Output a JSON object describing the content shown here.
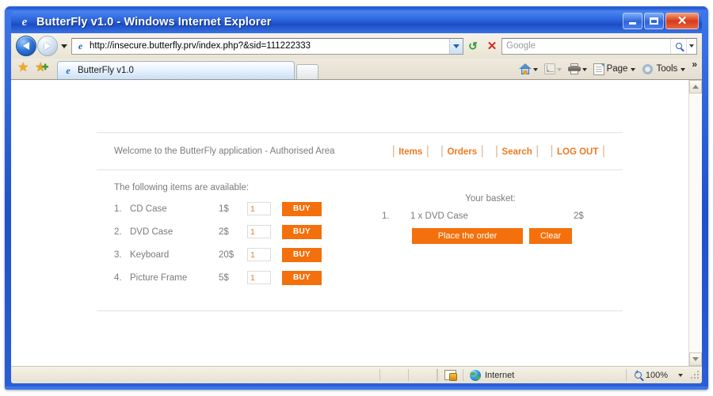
{
  "window": {
    "title": "ButterFly v1.0 - Windows Internet Explorer",
    "icon": "ie-logo-icon",
    "minimize_label": "Minimize",
    "maximize_label": "Maximize",
    "close_label": "Close"
  },
  "browser": {
    "back_label": "Back",
    "forward_label": "Forward",
    "history_dropdown_label": "Recent Pages",
    "address": {
      "url": "http://insecure.butterfly.prv/index.php?&sid=111222333",
      "icon": "ie-logo-icon",
      "dropdown_label": "Address history"
    },
    "refresh_label": "Refresh",
    "stop_label": "Stop",
    "search": {
      "placeholder": "Google",
      "go_label": "Search",
      "provider_dropdown_label": "Change search provider"
    },
    "favorites_center_label": "Favorites Center",
    "add_favorites_label": "Add to Favorites",
    "tabs": [
      {
        "label": "ButterFly v1.0",
        "icon": "ie-logo-icon",
        "active": true
      }
    ],
    "new_tab_label": "New Tab",
    "command_bar": [
      {
        "name": "home",
        "label": "",
        "icon": "home-icon",
        "has_dropdown": true,
        "enabled": true
      },
      {
        "name": "feeds",
        "label": "",
        "icon": "feed-icon",
        "has_dropdown": true,
        "enabled": false
      },
      {
        "name": "print",
        "label": "",
        "icon": "printer-icon",
        "has_dropdown": true,
        "enabled": true
      },
      {
        "name": "page",
        "label": "Page",
        "icon": "page-icon",
        "has_dropdown": true,
        "enabled": true
      },
      {
        "name": "tools",
        "label": "Tools",
        "icon": "gear-icon",
        "has_dropdown": true,
        "enabled": true
      }
    ],
    "command_overflow_label": "»"
  },
  "page": {
    "welcome": "Welcome to the ButterFly application - Authorised Area",
    "nav": [
      {
        "label": "Items",
        "id": "items"
      },
      {
        "label": "Orders",
        "id": "orders"
      },
      {
        "label": "Search",
        "id": "search"
      },
      {
        "label": "LOG OUT",
        "id": "logout"
      }
    ],
    "nav_pipe": "|",
    "items_heading": "The following items are available:",
    "items": [
      {
        "num": "1.",
        "name": "CD Case",
        "price": "1$",
        "qty": "1",
        "buy_label": "BUY"
      },
      {
        "num": "2.",
        "name": "DVD Case",
        "price": "2$",
        "qty": "1",
        "buy_label": "BUY"
      },
      {
        "num": "3.",
        "name": "Keyboard",
        "price": "20$",
        "qty": "1",
        "buy_label": "BUY"
      },
      {
        "num": "4.",
        "name": "Picture Frame",
        "price": "5$",
        "qty": "1",
        "buy_label": "BUY"
      }
    ],
    "basket": {
      "title": "Your basket:",
      "rows": [
        {
          "num": "1.",
          "desc": "1 x DVD Case",
          "price": "2$"
        }
      ],
      "order_label": "Place the order",
      "clear_label": "Clear"
    }
  },
  "statusbar": {
    "zone_label": "Internet",
    "zone_icon": "globe-icon",
    "protected_icon": "protected-mode-icon",
    "zoom_level": "100%",
    "zoom_icon": "zoom-icon",
    "zoom_dropdown_label": "Change zoom level"
  },
  "scrollbar": {
    "up_label": "Scroll up",
    "down_label": "Scroll down"
  },
  "colors": {
    "accent_orange": "#f4700c",
    "link_orange": "#ef7a22",
    "title_blue": "#2f62d8",
    "text_gray": "#7b7b7b"
  }
}
